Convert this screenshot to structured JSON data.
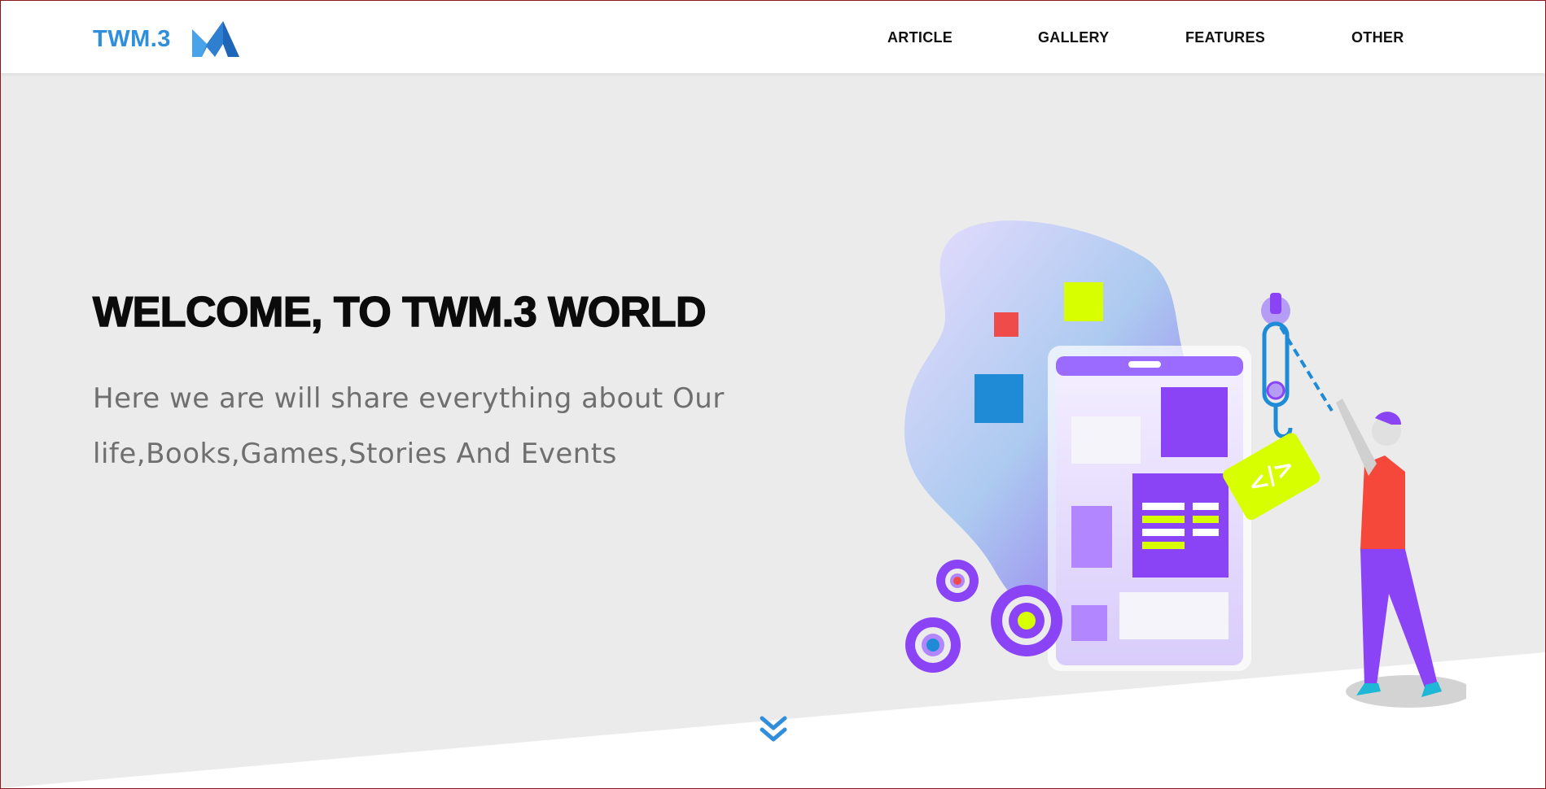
{
  "header": {
    "brand_name": "TWM.3",
    "brand_color": "#2f8fdd",
    "logo_icon": "twm-chevron-logo",
    "nav": [
      {
        "label": "ARTICLE"
      },
      {
        "label": "GALLERY"
      },
      {
        "label": "FEATURES"
      },
      {
        "label": "OTHER"
      }
    ]
  },
  "hero": {
    "title": "WELCOME, TO TWM.3 WORLD",
    "subtitle_line1": "Here we are will share everything about Our",
    "subtitle_line2": "life,Books,Games,Stories And Events",
    "illustration_icon": "developer-phone-illustration",
    "background_color": "#ebebeb",
    "scroll_icon": "double-chevron-down-icon",
    "accent_color": "#2f8fdd"
  }
}
